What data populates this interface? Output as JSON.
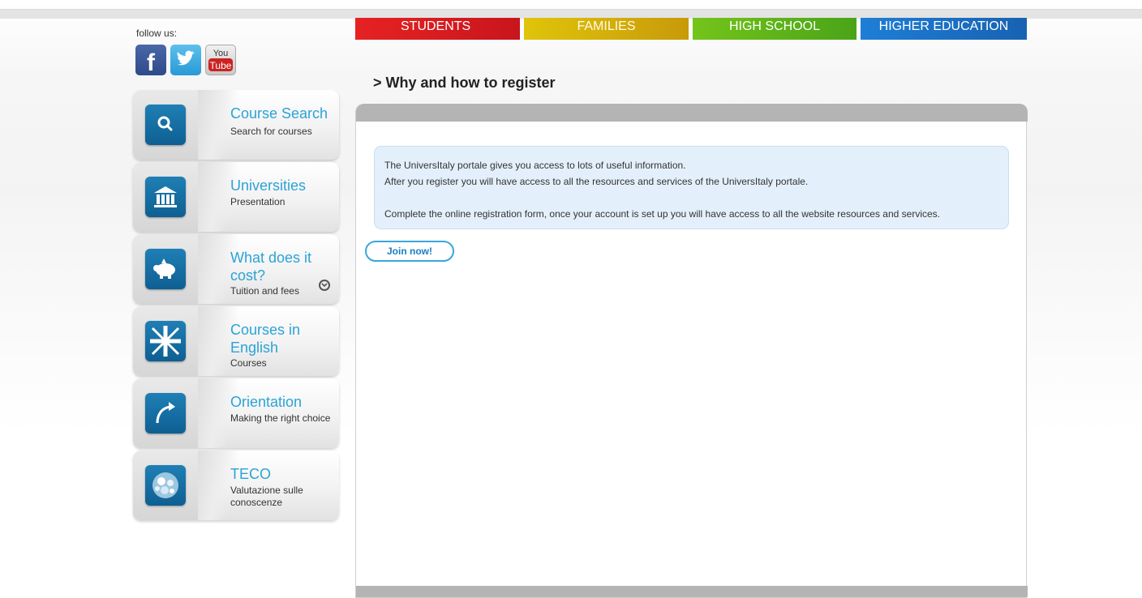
{
  "nav": {
    "students": "STUDENTS",
    "families": "FAMILIES",
    "high_school": "HIGH SCHOOL",
    "higher_education": "HIGHER EDUCATION"
  },
  "follow_label": "follow us:",
  "social": [
    {
      "name": "facebook",
      "icon": "facebook-icon",
      "color": "#3b5998"
    },
    {
      "name": "twitter",
      "icon": "twitter-icon",
      "color": "#1da1f2"
    },
    {
      "name": "youtube",
      "icon": "youtube-icon",
      "color": "#cc181e",
      "text_top": "You",
      "text_bottom": "Tube"
    }
  ],
  "sidebar": {
    "items": [
      {
        "title": "Course Search",
        "subtitle": "Search for courses",
        "icon": "search-icon"
      },
      {
        "title": "Universities",
        "subtitle": "Presentation",
        "icon": "university-building-icon"
      },
      {
        "title": "What does it cost?",
        "subtitle": "Tuition and fees",
        "icon": "piggy-bank-icon"
      },
      {
        "title": "Courses in English",
        "subtitle": "Courses",
        "icon": "union-jack-flag-icon"
      },
      {
        "title": "Orientation",
        "subtitle": "Making the right choice",
        "icon": "curved-arrow-icon"
      },
      {
        "title": "TECO",
        "subtitle": "Valutazione sulle conoscenze",
        "icon": "teco-logo-icon"
      }
    ]
  },
  "main": {
    "page_title": "> Why and how to register",
    "info_lines": [
      "The UniversItaly portale gives you access to lots of useful information.",
      "After you register you will have access to all the resources and services of the UniversItaly portale.",
      "Complete the online registration form, once your account is set up you will have access to all the website resources and services."
    ],
    "join_button": "Join now!"
  },
  "colors": {
    "students": "#e22020",
    "families": "#d8b80a",
    "high_school": "#66b81a",
    "higher_education": "#1a70c8",
    "accent_text": "#2ba3d6"
  }
}
